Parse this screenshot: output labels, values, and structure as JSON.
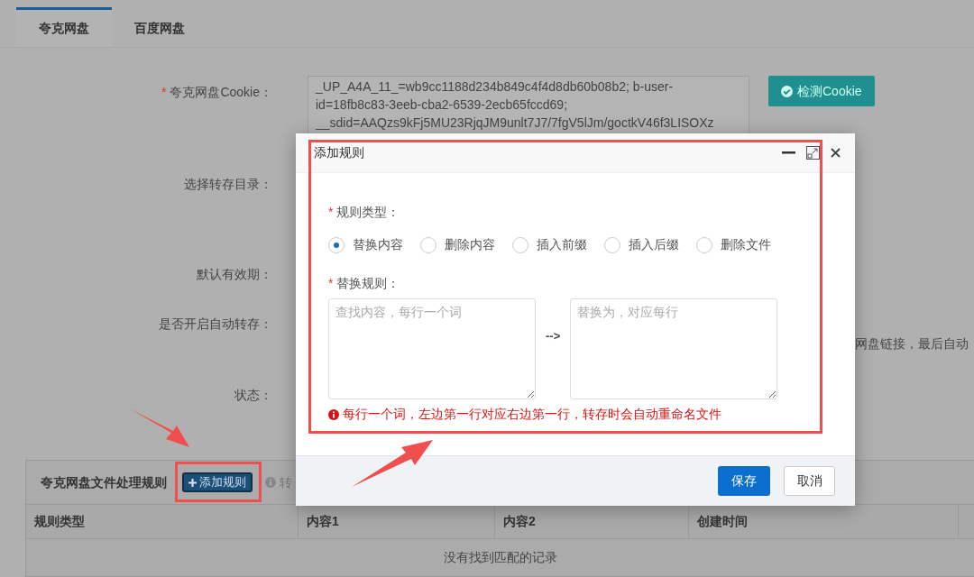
{
  "tabs": [
    {
      "label": "夸克网盘",
      "selected": true
    },
    {
      "label": "百度网盘",
      "selected": false
    }
  ],
  "form": {
    "cookie_label": "夸克网盘Cookie：",
    "cookie_mark": "*",
    "cookie_lines": [
      "_UP_A4A_11_=wb9cc1188d234b849c4f4d8db60b08b2; b-user-",
      "id=18fb8c83-3eeb-cba2-6539-2ecb65fccd69;",
      "__sdid=AAQzs9kFj5MU23RjqJM9unlt7J7/7fgV5lJm/goctkV46f3LISOXz"
    ],
    "check_button": "检测Cookie",
    "labels": [
      "选择转存目录：",
      "默认有效期：",
      "是否开启自动转存：",
      "状态："
    ],
    "partial_hint": "网盘链接，最后自动"
  },
  "rules_panel": {
    "title": "夸克网盘文件处理规则",
    "add_button": "添加规则",
    "hint": "转",
    "columns": [
      "规则类型",
      "内容1",
      "内容2",
      "创建时间"
    ],
    "empty_text": "没有找到匹配的记录"
  },
  "dialog": {
    "title": "添加规则",
    "type_label": "规则类型：",
    "type_mark": "*",
    "types": [
      {
        "label": "替换内容",
        "selected": true
      },
      {
        "label": "删除内容",
        "selected": false
      },
      {
        "label": "插入前缀",
        "selected": false
      },
      {
        "label": "插入后缀",
        "selected": false
      },
      {
        "label": "删除文件",
        "selected": false
      }
    ],
    "rule_label": "替换规则：",
    "rule_mark": "*",
    "find_placeholder": "查找内容，每行一个词",
    "arrow": "-->",
    "replace_placeholder": "替换为，对应每行",
    "error": "每行一个词，左边第一行对应右边第一行，转存时会自动重命名文件",
    "save": "保存",
    "cancel": "取消"
  }
}
